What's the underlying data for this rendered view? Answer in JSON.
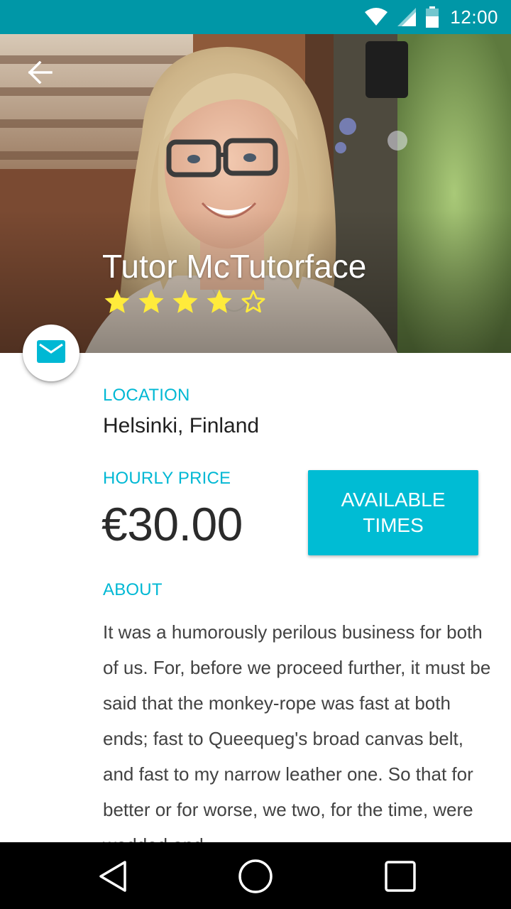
{
  "status_bar": {
    "time": "12:00",
    "icons": [
      "wifi-icon",
      "cell-signal-icon",
      "battery-icon"
    ]
  },
  "header": {
    "back_icon": "arrow-back-icon",
    "tutor_name": "Tutor McTutorface",
    "rating": {
      "value": 4,
      "max": 5,
      "filled_icon": "star-filled-icon",
      "empty_icon": "star-outline-icon"
    }
  },
  "message_button": {
    "icon": "mail-icon"
  },
  "location": {
    "label": "LOCATION",
    "value": "Helsinki, Finland"
  },
  "price": {
    "label": "HOURLY PRICE",
    "value": "€30.00"
  },
  "available_button": {
    "label": "AVAILABLE TIMES"
  },
  "about": {
    "label": "ABOUT",
    "text": "It was a humorously perilous business for both of us. For, before we proceed further, it must be said that the monkey-rope was fast at both ends; fast to Queequeg's broad canvas belt, and fast to my narrow leather one. So that for better or for worse, we two, for the time, were wedded and"
  },
  "nav_bar": {
    "icons": [
      "nav-back-icon",
      "nav-home-icon",
      "nav-recents-icon"
    ]
  },
  "colors": {
    "status_bar": "#0097a7",
    "accent": "#00bcd4",
    "label": "#00b8d4",
    "star": "#ffeb3b"
  }
}
